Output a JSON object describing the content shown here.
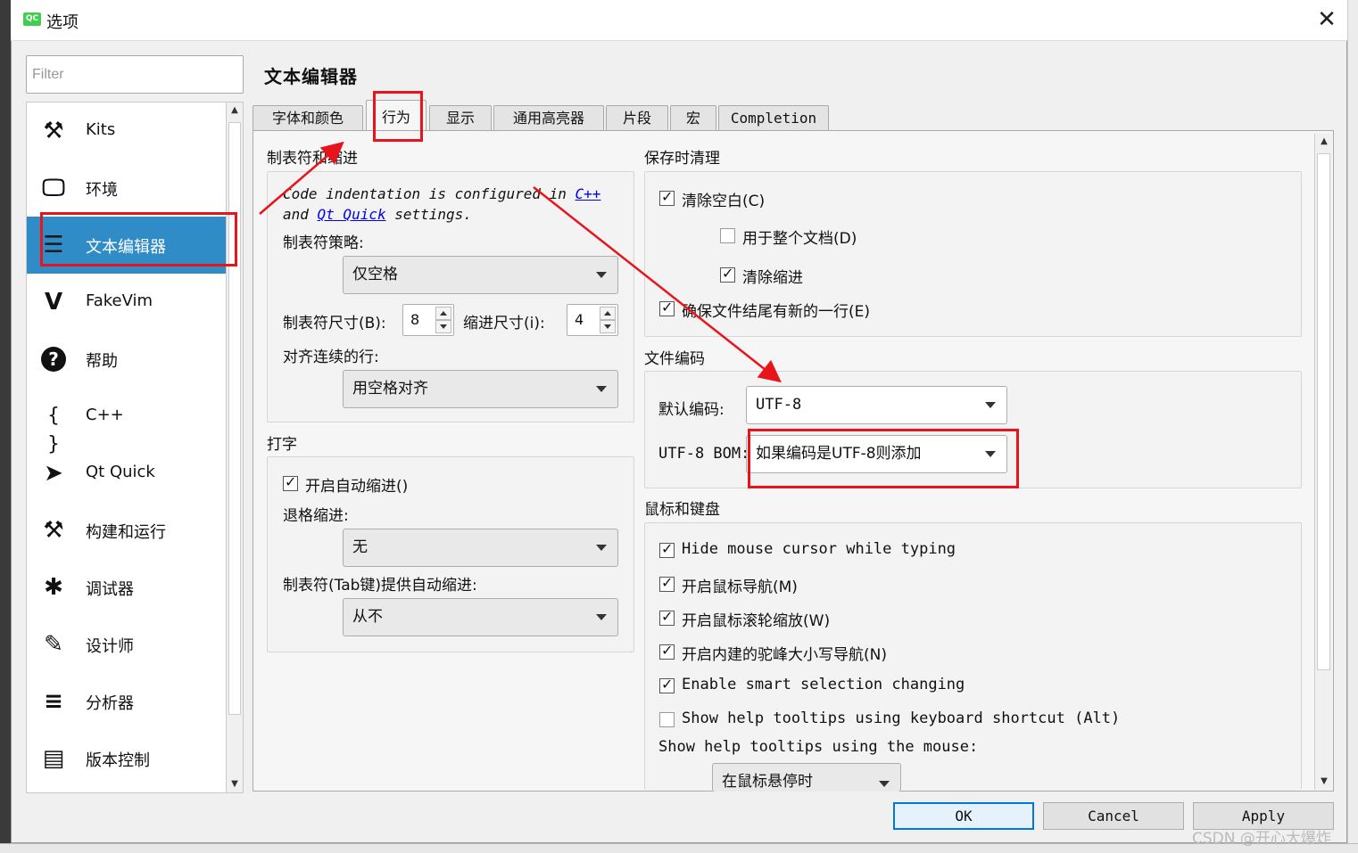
{
  "window": {
    "title": "选项",
    "app_icon": "QC",
    "close_glyph": "✕"
  },
  "filter": {
    "placeholder": "Filter"
  },
  "sidebar": {
    "items": [
      {
        "label": "Kits",
        "icon": "kits-icon",
        "glyph": "⚒"
      },
      {
        "label": "环境",
        "icon": "monitor-icon",
        "glyph": "🖵"
      },
      {
        "label": "文本编辑器",
        "icon": "text-editor-icon",
        "glyph": "☰"
      },
      {
        "label": "FakeVim",
        "icon": "fakevim-icon",
        "glyph": "V"
      },
      {
        "label": "帮助",
        "icon": "help-icon",
        "glyph": "?"
      },
      {
        "label": "C++",
        "icon": "braces-icon",
        "glyph": "{ }"
      },
      {
        "label": "Qt Quick",
        "icon": "paper-plane-icon",
        "glyph": "➤"
      },
      {
        "label": "构建和运行",
        "icon": "hammer-icon",
        "glyph": "⚒"
      },
      {
        "label": "调试器",
        "icon": "bug-icon",
        "glyph": "✱"
      },
      {
        "label": "设计师",
        "icon": "pencil-icon",
        "glyph": "✎"
      },
      {
        "label": "分析器",
        "icon": "analyzer-icon",
        "glyph": "≡"
      },
      {
        "label": "版本控制",
        "icon": "version-control-icon",
        "glyph": "▤"
      }
    ],
    "selected_index": 2
  },
  "page": {
    "title": "文本编辑器"
  },
  "tabs": [
    "字体和颜色",
    "行为",
    "显示",
    "通用高亮器",
    "片段",
    "宏",
    "Completion"
  ],
  "active_tab": "行为",
  "tabs_indent": {
    "section": "制表符和缩进",
    "note_prefix": "Code indentation is configured in ",
    "note_link1": "C++",
    "note_mid": " and ",
    "note_link2": "Qt Quick",
    "note_suffix": " settings.",
    "tab_policy_label": "制表符策略:",
    "tab_policy_value": "仅空格",
    "tab_size_label": "制表符尺寸(B):",
    "tab_size_value": "8",
    "indent_size_label": "缩进尺寸(i):",
    "indent_size_value": "4",
    "align_label": "对齐连续的行:",
    "align_value": "用空格对齐"
  },
  "typing": {
    "section": "打字",
    "auto_indent_label": "开启自动缩进()",
    "auto_indent_checked": true,
    "backspace_label": "退格缩进:",
    "backspace_value": "无",
    "tab_key_label": "制表符(Tab键)提供自动缩进:",
    "tab_key_value": "从不"
  },
  "cleanup": {
    "section": "保存时清理",
    "clean_whitespace": {
      "label": "清除空白(C)",
      "checked": true
    },
    "entire_doc": {
      "label": "用于整个文档(D)",
      "checked": false
    },
    "clean_indent": {
      "label": "清除缩进",
      "checked": true
    },
    "newline_eof": {
      "label": "确保文件结尾有新的一行(E)",
      "checked": true
    }
  },
  "encoding": {
    "section": "文件编码",
    "default_label": "默认编码:",
    "default_value": "UTF-8",
    "bom_label": "UTF-8 BOM:",
    "bom_value": "如果编码是UTF-8则添加"
  },
  "mouse": {
    "section": "鼠标和键盘",
    "items": [
      {
        "label": "Hide mouse cursor while typing",
        "checked": true
      },
      {
        "label": "开启鼠标导航(M)",
        "checked": true
      },
      {
        "label": "开启鼠标滚轮缩放(W)",
        "checked": true
      },
      {
        "label": "开启内建的驼峰大小写导航(N)",
        "checked": true
      },
      {
        "label": "Enable smart selection changing",
        "checked": true
      },
      {
        "label": "Show help tooltips using keyboard shortcut (Alt)",
        "checked": false
      }
    ],
    "tooltips_label": "Show help tooltips using the mouse:",
    "tooltips_value": "在鼠标悬停时"
  },
  "buttons": {
    "ok": "OK",
    "cancel": "Cancel",
    "apply": "Apply"
  },
  "watermark": "CSDN @开心大爆炸",
  "colors": {
    "selection": "#308cc6",
    "annotation_red": "#e8141b",
    "qt_green": "#41cd52",
    "link": "#0000ee"
  }
}
